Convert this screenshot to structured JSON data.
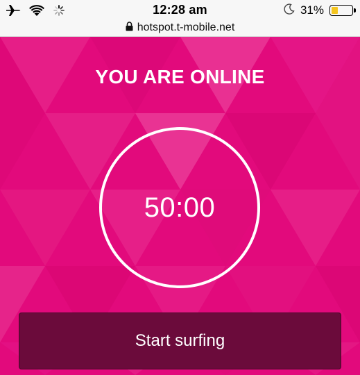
{
  "status_bar": {
    "time": "12:28 am",
    "battery_percent": "31%",
    "battery_level": 0.31,
    "battery_color": "#f4c51f",
    "left_icons": [
      "airplane-icon",
      "wifi-icon",
      "loading-spinner-icon"
    ],
    "right_icons": [
      "moon-icon",
      "battery-icon"
    ]
  },
  "browser": {
    "url": "hotspot.t-mobile.net",
    "secure_icon": "lock-icon"
  },
  "page": {
    "headline": "YOU ARE ONLINE",
    "timer": "50:00",
    "start_button_label": "Start surfing",
    "brand_color": "#e20a7c",
    "button_color": "#6b0b3b"
  }
}
